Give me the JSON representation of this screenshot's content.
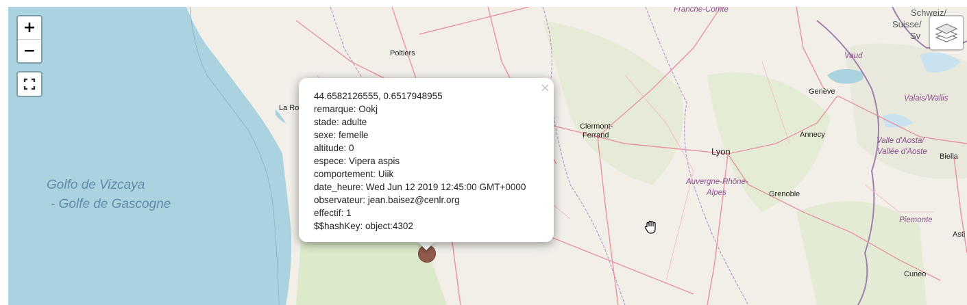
{
  "controls": {
    "zoom_in": "+",
    "zoom_out": "−",
    "fullscreen_icon": "fullscreen-icon",
    "layers_icon": "layers-icon"
  },
  "labels": {
    "franche_comte": "Franche-Comté",
    "schweiz": "Schweiz/",
    "suisse": "Suisse/",
    "sv": "Sv",
    "poitiers": "Poitiers",
    "la_ro": "La Ro",
    "vaud": "Vaud",
    "geneve": "Genève",
    "valais": "Valais/Wallis",
    "clermont1": "Clermont-",
    "clermont2": "Ferrand",
    "lyon": "Lyon",
    "annecy": "Annecy",
    "aosta1": "Valle d'Aosta/",
    "aosta2": "Vallée d'Aoste",
    "biella": "Biella",
    "aura1": "Auvergne-Rhône-",
    "aura2": "Alpes",
    "grenoble": "Grenoble",
    "sea1": "Golfo de Vizcaya",
    "sea2": "- Golfe de Gascogne",
    "piemonte": "Piemonte",
    "asti": "Asti",
    "cuneo": "Cuneo"
  },
  "popup": {
    "close": "×",
    "lines": [
      "44.6582126555, 0.6517948955",
      "remarque: Ookj",
      "stade: adulte",
      "sexe: femelle",
      "altitude: 0",
      "espece: Vipera aspis",
      "comportement: Uiik",
      "date_heure: Wed Jun 12 2019 12:45:00 GMT+0000",
      "observateur: jean.baisez@cenlr.org",
      "effectif: 1",
      "$$hashKey: object:4302"
    ]
  },
  "colors": {
    "sea": "#aad3df",
    "land": "#f2efe9",
    "forest": "#cde6b8",
    "road": "#e892a2",
    "border": "#9e7fae",
    "marker": "#8c5346"
  }
}
